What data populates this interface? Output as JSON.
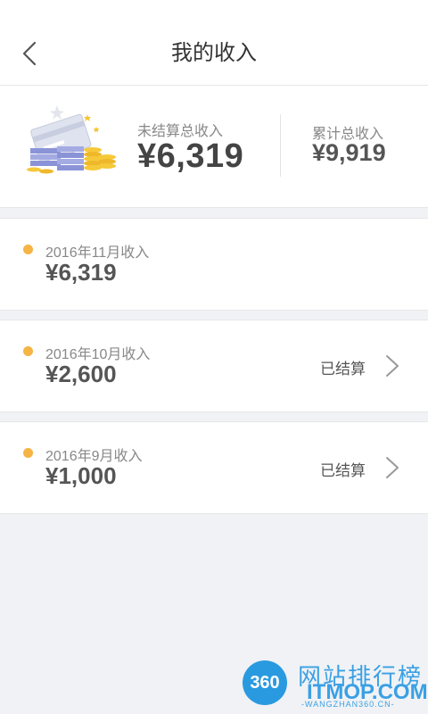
{
  "nav": {
    "title": "我的收入",
    "back_icon": "chevron-left-icon"
  },
  "summary": {
    "unsettled_label": "未结算总收入",
    "unsettled_amount": "¥6,319",
    "total_label": "累计总收入",
    "total_amount": "¥9,919"
  },
  "months": [
    {
      "label": "2016年11月收入",
      "amount": "¥6,319",
      "status": ""
    },
    {
      "label": "2016年10月收入",
      "amount": "¥2,600",
      "status": "已结算"
    },
    {
      "label": "2016年9月收入",
      "amount": "¥1,000",
      "status": "已结算"
    }
  ],
  "watermark": {
    "badge": "360",
    "title": "网站排行榜",
    "domain": "ITMOP.COM",
    "url": "-WANGZHAN360.CN-"
  },
  "colors": {
    "accent_dot": "#f5b443",
    "page_bg": "#f0f2f5",
    "watermark": "#2a9ae0"
  }
}
